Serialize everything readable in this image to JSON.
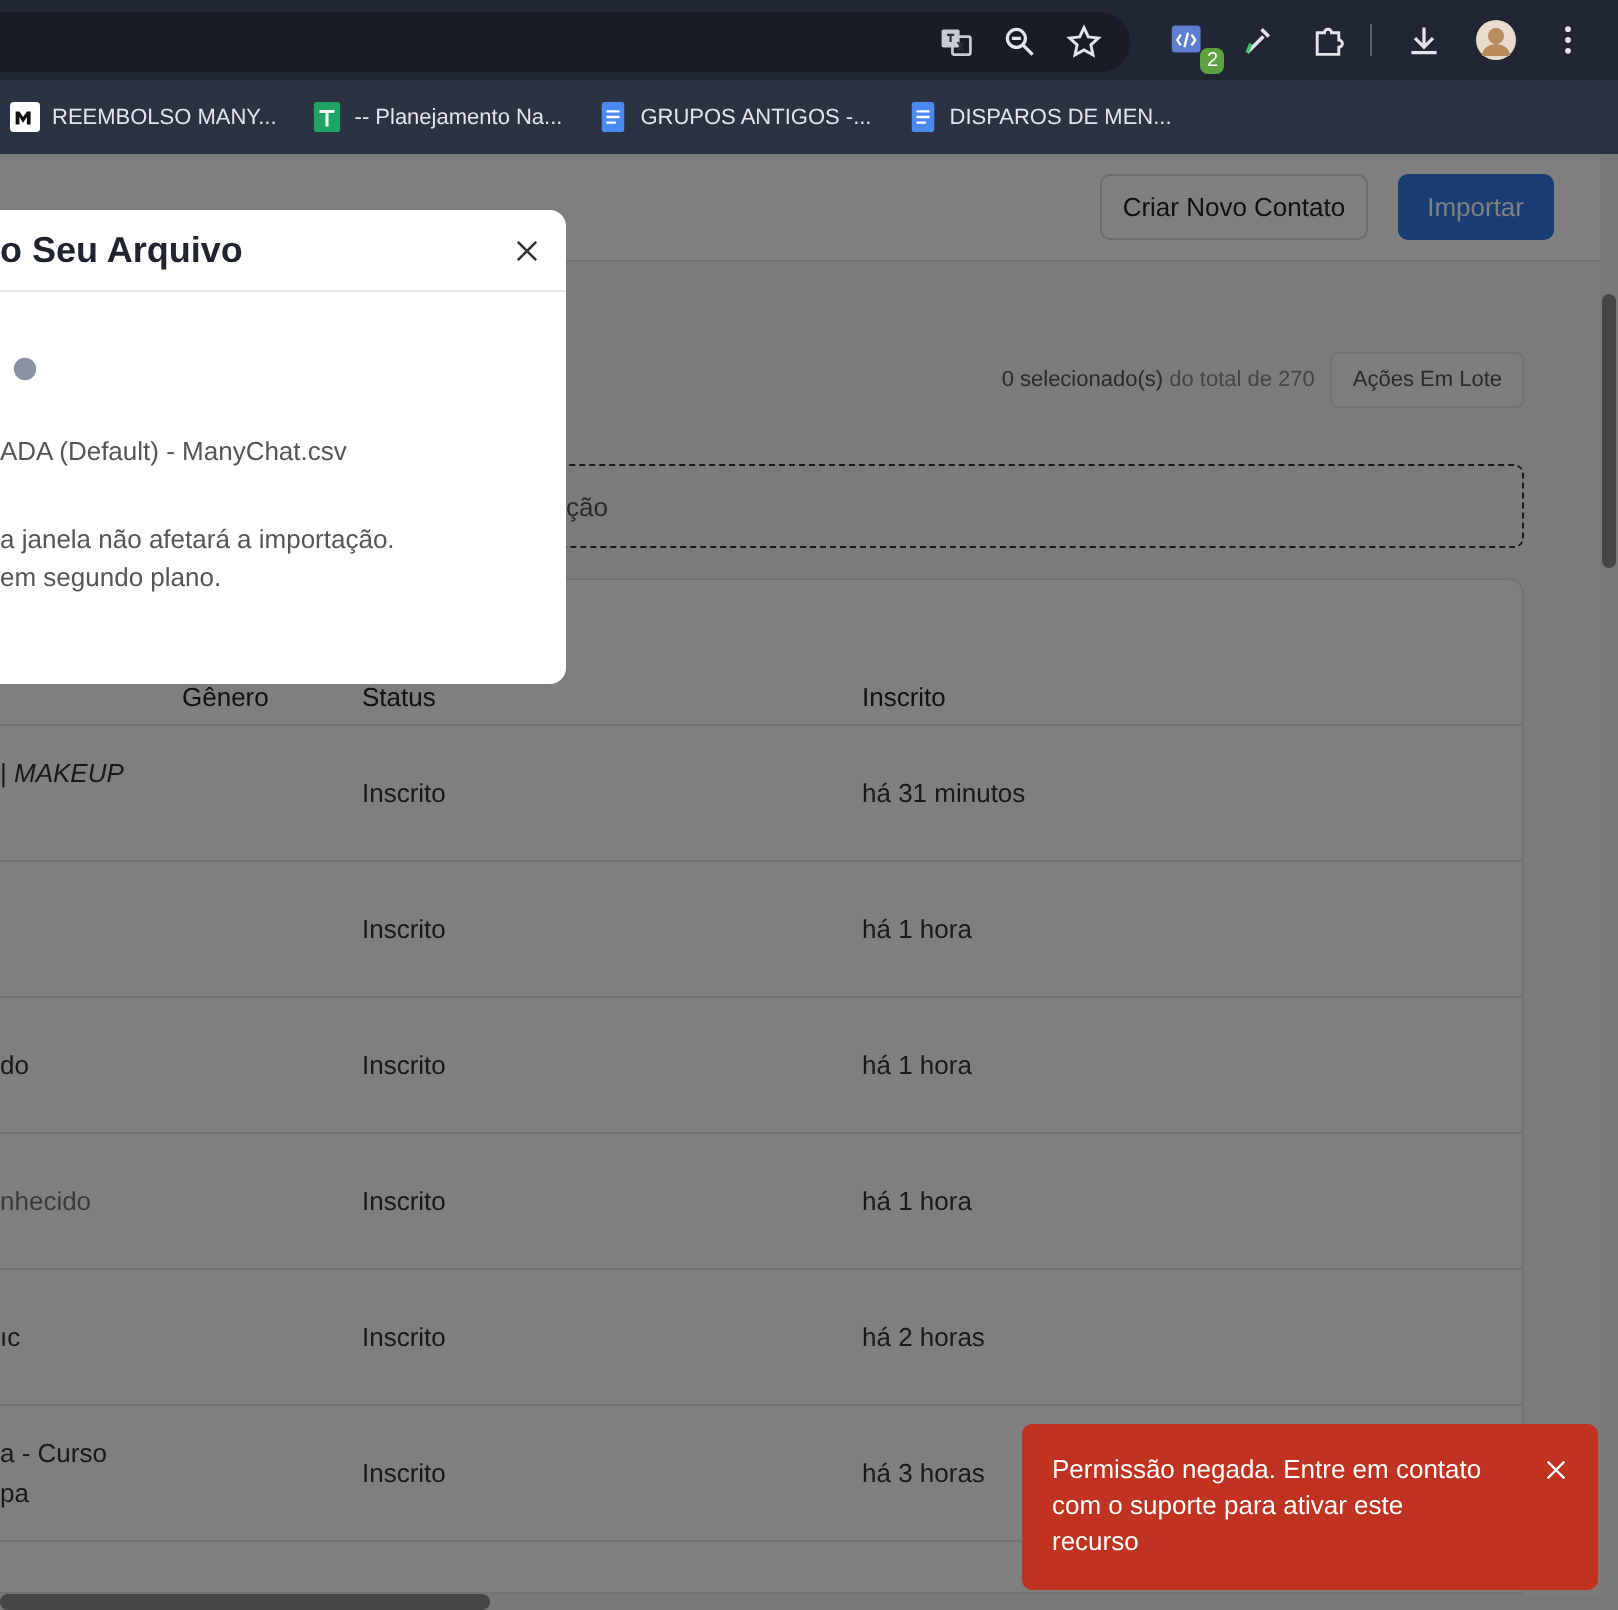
{
  "browser": {
    "extension_badge": "2",
    "bookmarks": [
      {
        "label": "REEMBOLSO MANY...",
        "kind": "logo"
      },
      {
        "label": "-- Planejamento Na...",
        "kind": "sheet"
      },
      {
        "label": "GRUPOS ANTIGOS -...",
        "kind": "doc"
      },
      {
        "label": "DISPAROS DE MEN...",
        "kind": "doc"
      }
    ]
  },
  "header": {
    "buttons": [
      {
        "label": "Criar Novo Contato",
        "kind": "secondary"
      },
      {
        "label": "Importar",
        "kind": "primary"
      }
    ]
  },
  "toolbar": {
    "selection_count": "0 selecionado(s)",
    "selection_total": "do total de 270",
    "bulk_button": "Ações Em Lote"
  },
  "dropzone": {
    "text": "ção"
  },
  "table": {
    "columns": [
      "Gênero",
      "Status",
      "Inscrito"
    ],
    "rows": [
      {
        "column_1": "| *MAKEUP*",
        "muted": false,
        "status": "Inscrito",
        "subscribed": "há 31 minutos"
      },
      {
        "status": "Inscrito",
        "subscribed": "há 1 hora"
      },
      {
        "column_1": "do",
        "muted": false,
        "status": "Inscrito",
        "subscribed": "há 1 hora"
      },
      {
        "column_1": "nhecido",
        "muted": true,
        "status": "Inscrito",
        "subscribed": "há 1 hora"
      },
      {
        "column_1": "ıc",
        "muted": false,
        "status": "Inscrito",
        "subscribed": "há 2 horas"
      },
      {
        "column_1": "a - Curso\npa",
        "muted": false,
        "status": "Inscrito",
        "subscribed": "há 3 horas"
      }
    ]
  },
  "modal": {
    "title": "o Seu Arquivo",
    "file_name": "ADA (Default) - ManyChat.csv",
    "note_lines": [
      "a janela não afetará a importação.",
      "em segundo plano."
    ]
  },
  "toast": {
    "message": "Permissão negada. Entre em contato com o suporte para ativar este recurso"
  }
}
